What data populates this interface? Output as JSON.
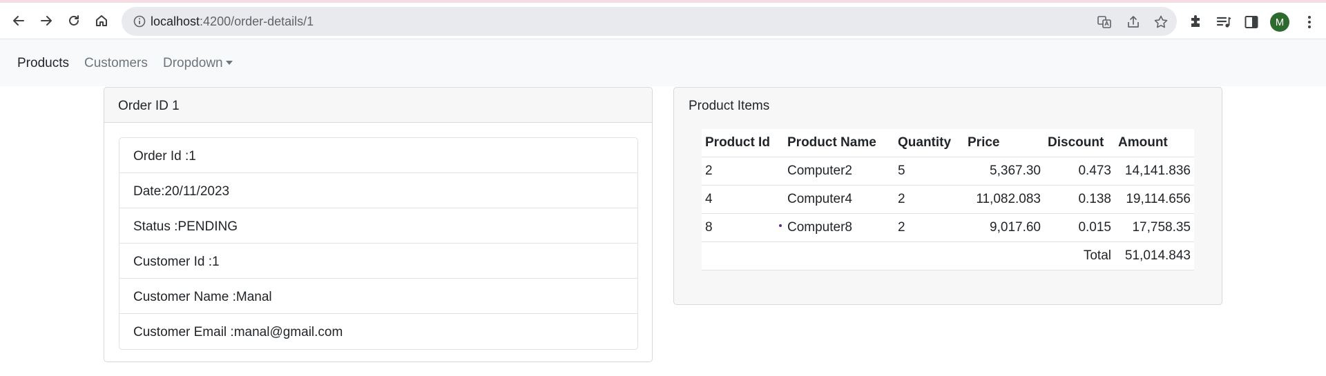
{
  "browser": {
    "url_host": "localhost",
    "url_path": ":4200/order-details/1",
    "profile_initial": "M"
  },
  "navbar": {
    "links": [
      {
        "label": "Products"
      },
      {
        "label": "Customers"
      },
      {
        "label": "Dropdown"
      }
    ]
  },
  "order": {
    "header": "Order ID 1",
    "fields": [
      "Order Id :1",
      "Date:20/11/2023",
      "Status :PENDING",
      "Customer Id :1",
      "Customer Name :Manal",
      "Customer Email :manal@gmail.com"
    ]
  },
  "items": {
    "title": "Product Items",
    "columns": [
      "Product Id",
      "Product Name",
      "Quantity",
      "Price",
      "Discount",
      "Amount"
    ],
    "rows": [
      [
        "2",
        "Computer2",
        "5",
        "5,367.30",
        "0.473",
        "14,141.836"
      ],
      [
        "4",
        "Computer4",
        "2",
        "11,082.083",
        "0.138",
        "19,114.656"
      ],
      [
        "8",
        "Computer8",
        "2",
        "9,017.60",
        "0.015",
        "17,758.35"
      ]
    ],
    "total_label": "Total",
    "total_value": "51,014.843"
  },
  "icons": {
    "back": "arrow-left-icon",
    "forward": "arrow-right-icon",
    "reload": "reload-icon",
    "home": "home-icon",
    "site_info": "info-icon",
    "translate": "translate-icon",
    "share": "share-icon",
    "bookmark": "star-icon",
    "extensions": "puzzle-icon",
    "media": "playlist-icon",
    "side_panel": "side-panel-icon",
    "menu": "kebab-menu-icon"
  }
}
